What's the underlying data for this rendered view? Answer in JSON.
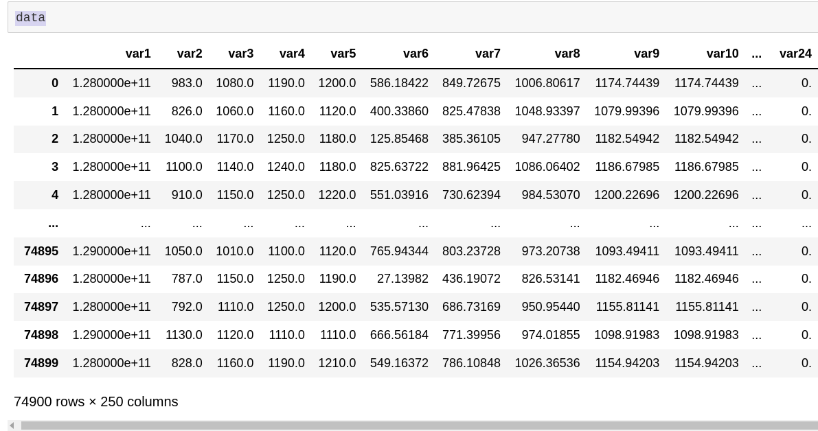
{
  "code_cell": {
    "text": "data"
  },
  "table": {
    "columns": [
      "",
      "var1",
      "var2",
      "var3",
      "var4",
      "var5",
      "var6",
      "var7",
      "var8",
      "var9",
      "var10",
      "...",
      "var24"
    ],
    "rows": [
      [
        "0",
        "1.280000e+11",
        "983.0",
        "1080.0",
        "1190.0",
        "1200.0",
        "586.18422",
        "849.72675",
        "1006.80617",
        "1174.74439",
        "1174.74439",
        "...",
        "0."
      ],
      [
        "1",
        "1.280000e+11",
        "826.0",
        "1060.0",
        "1160.0",
        "1120.0",
        "400.33860",
        "825.47838",
        "1048.93397",
        "1079.99396",
        "1079.99396",
        "...",
        "0."
      ],
      [
        "2",
        "1.280000e+11",
        "1040.0",
        "1170.0",
        "1250.0",
        "1180.0",
        "125.85468",
        "385.36105",
        "947.27780",
        "1182.54942",
        "1182.54942",
        "...",
        "0."
      ],
      [
        "3",
        "1.280000e+11",
        "1100.0",
        "1140.0",
        "1240.0",
        "1180.0",
        "825.63722",
        "881.96425",
        "1086.06402",
        "1186.67985",
        "1186.67985",
        "...",
        "0."
      ],
      [
        "4",
        "1.280000e+11",
        "910.0",
        "1150.0",
        "1250.0",
        "1220.0",
        "551.03916",
        "730.62394",
        "984.53070",
        "1200.22696",
        "1200.22696",
        "...",
        "0."
      ],
      [
        "...",
        "...",
        "...",
        "...",
        "...",
        "...",
        "...",
        "...",
        "...",
        "...",
        "...",
        "...",
        "..."
      ],
      [
        "74895",
        "1.290000e+11",
        "1050.0",
        "1010.0",
        "1100.0",
        "1120.0",
        "765.94344",
        "803.23728",
        "973.20738",
        "1093.49411",
        "1093.49411",
        "...",
        "0."
      ],
      [
        "74896",
        "1.280000e+11",
        "787.0",
        "1150.0",
        "1250.0",
        "1190.0",
        "27.13982",
        "436.19072",
        "826.53141",
        "1182.46946",
        "1182.46946",
        "...",
        "0."
      ],
      [
        "74897",
        "1.280000e+11",
        "792.0",
        "1110.0",
        "1250.0",
        "1200.0",
        "535.57130",
        "686.73169",
        "950.95440",
        "1155.81141",
        "1155.81141",
        "...",
        "0."
      ],
      [
        "74898",
        "1.290000e+11",
        "1130.0",
        "1120.0",
        "1110.0",
        "1110.0",
        "666.56184",
        "771.39956",
        "974.01855",
        "1098.91983",
        "1098.91983",
        "...",
        "0."
      ],
      [
        "74899",
        "1.280000e+11",
        "828.0",
        "1160.0",
        "1190.0",
        "1210.0",
        "549.16372",
        "786.10848",
        "1026.36536",
        "1154.94203",
        "1154.94203",
        "...",
        "0."
      ]
    ]
  },
  "summary": "74900 rows × 250 columns",
  "scrollbar": {
    "direction": "horizontal",
    "arrow_icon": "scroll-left-arrow-icon"
  }
}
